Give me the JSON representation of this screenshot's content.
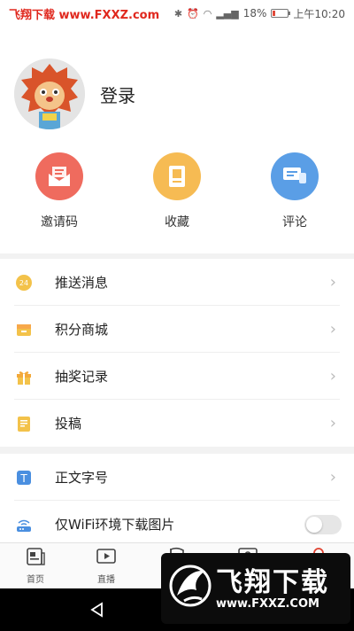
{
  "status_bar": {
    "watermark": "飞翔下载 www.FXXZ.com",
    "battery": "18%",
    "time": "上午10:20"
  },
  "profile": {
    "login_label": "登录"
  },
  "quick_actions": [
    {
      "label": "邀请码",
      "color": "#ef6b5e",
      "icon": "envelope-icon"
    },
    {
      "label": "收藏",
      "color": "#f6bb53",
      "icon": "bookmark-icon"
    },
    {
      "label": "评论",
      "color": "#5a9ee6",
      "icon": "comment-icon"
    }
  ],
  "menu_group_1": [
    {
      "label": "推送消息",
      "icon": "push-clock-icon"
    },
    {
      "label": "积分商城",
      "icon": "mall-icon"
    },
    {
      "label": "抽奖记录",
      "icon": "gift-icon"
    },
    {
      "label": "投稿",
      "icon": "document-icon"
    }
  ],
  "menu_group_2": [
    {
      "label": "正文字号",
      "icon": "font-size-icon"
    },
    {
      "label": "仅WiFi环境下载图片",
      "icon": "wifi-router-icon",
      "toggle": false
    }
  ],
  "tab_bar": [
    {
      "label": "首页",
      "icon": "newspaper-icon"
    },
    {
      "label": "直播",
      "icon": "video-icon"
    },
    {
      "label": "",
      "icon": "flag-icon"
    },
    {
      "label": "",
      "icon": "message-icon"
    },
    {
      "label": "",
      "icon": "user-icon"
    }
  ],
  "overlay": {
    "title": "飞翔下载",
    "url": "www.FXXZ.COM"
  },
  "colors": {
    "accent_red": "#e0281e",
    "active_tab": "#e0412f"
  }
}
